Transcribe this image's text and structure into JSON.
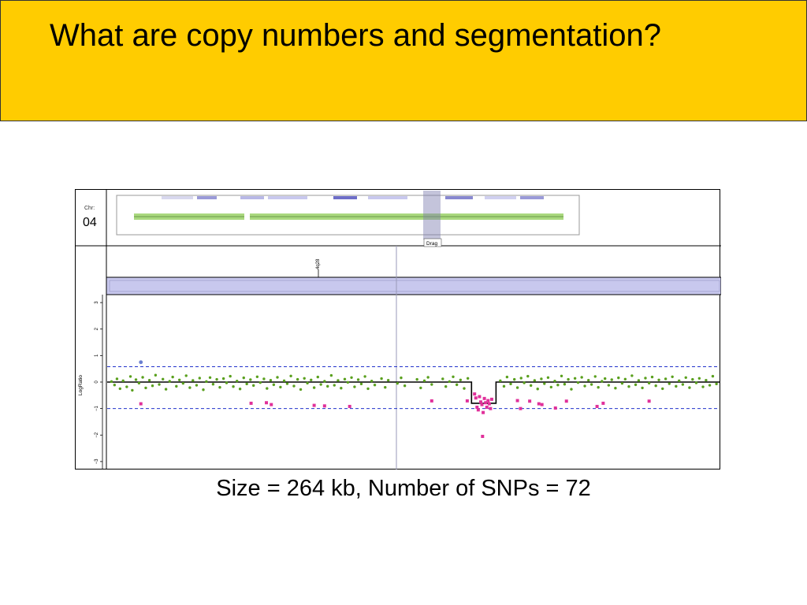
{
  "slide": {
    "title": "What are copy numbers and segmentation?",
    "caption": "Size = 264 kb, Number of SNPs = 72"
  },
  "colors": {
    "header_bg": "#ffcc00",
    "normal_points": "#5aa01e",
    "loss_points": "#e0309a",
    "outlier_point": "#6a7fd0",
    "threshold_lines": "#2233cc",
    "segment_line": "#000000",
    "track_fill": "#c8c8ee"
  },
  "chromosome_panel": {
    "chr_label": "Chr:",
    "chr_value": "04",
    "drag_label": "Drag"
  },
  "band_label": "4q28",
  "chart_data": {
    "type": "scatter",
    "title": "",
    "xlabel": "",
    "ylabel": "LogRatio",
    "ylim": [
      -3.3,
      3.3
    ],
    "yticks": [
      3,
      2,
      1,
      0,
      -1,
      -2,
      -3
    ],
    "ytick_labels": [
      "3",
      "2",
      "1",
      "0",
      "−1",
      "−2",
      "−3"
    ],
    "xlim": [
      0,
      1
    ],
    "thresholds": [
      0.58,
      -1.0
    ],
    "segments": [
      {
        "x": [
          0.0,
          0.595
        ],
        "y": 0.0
      },
      {
        "x": [
          0.595,
          0.635
        ],
        "y": -0.8
      },
      {
        "x": [
          0.635,
          1.0
        ],
        "y": 0.0
      }
    ],
    "series": [
      {
        "name": "",
        "role": "normal",
        "points": [
          [
            0.007,
            0.02
          ],
          [
            0.012,
            -0.11
          ],
          [
            0.016,
            0.12
          ],
          [
            0.021,
            -0.25
          ],
          [
            0.026,
            0.05
          ],
          [
            0.032,
            -0.18
          ],
          [
            0.038,
            0.21
          ],
          [
            0.041,
            -0.31
          ],
          [
            0.047,
            0.09
          ],
          [
            0.052,
            -0.04
          ],
          [
            0.058,
            0.18
          ],
          [
            0.063,
            -0.22
          ],
          [
            0.069,
            0.07
          ],
          [
            0.074,
            -0.14
          ],
          [
            0.079,
            0.26
          ],
          [
            0.085,
            -0.09
          ],
          [
            0.091,
            0.11
          ],
          [
            0.096,
            -0.27
          ],
          [
            0.102,
            0.03
          ],
          [
            0.107,
            0.19
          ],
          [
            0.113,
            -0.16
          ],
          [
            0.118,
            0.08
          ],
          [
            0.124,
            -0.05
          ],
          [
            0.129,
            0.24
          ],
          [
            0.135,
            -0.21
          ],
          [
            0.14,
            0.06
          ],
          [
            0.146,
            -0.12
          ],
          [
            0.151,
            0.15
          ],
          [
            0.157,
            -0.29
          ],
          [
            0.162,
            0.02
          ],
          [
            0.168,
            0.17
          ],
          [
            0.173,
            -0.08
          ],
          [
            0.179,
            0.1
          ],
          [
            0.184,
            -0.2
          ],
          [
            0.19,
            0.13
          ],
          [
            0.195,
            -0.03
          ],
          [
            0.201,
            0.22
          ],
          [
            0.206,
            -0.17
          ],
          [
            0.212,
            0.04
          ],
          [
            0.217,
            -0.26
          ],
          [
            0.223,
            0.16
          ],
          [
            0.228,
            -0.07
          ],
          [
            0.234,
            0.09
          ],
          [
            0.239,
            -0.13
          ],
          [
            0.245,
            0.2
          ],
          [
            0.25,
            -0.02
          ],
          [
            0.256,
            0.12
          ],
          [
            0.261,
            -0.24
          ],
          [
            0.267,
            0.07
          ],
          [
            0.272,
            -0.1
          ],
          [
            0.278,
            0.18
          ],
          [
            0.283,
            -0.19
          ],
          [
            0.289,
            0.05
          ],
          [
            0.294,
            -0.06
          ],
          [
            0.3,
            0.23
          ],
          [
            0.305,
            -0.15
          ],
          [
            0.311,
            0.1
          ],
          [
            0.316,
            -0.28
          ],
          [
            0.322,
            0.14
          ],
          [
            0.327,
            -0.04
          ],
          [
            0.333,
            0.08
          ],
          [
            0.338,
            -0.21
          ],
          [
            0.344,
            0.19
          ],
          [
            0.349,
            -0.09
          ],
          [
            0.355,
            0.03
          ],
          [
            0.36,
            -0.16
          ],
          [
            0.366,
            0.25
          ],
          [
            0.371,
            -0.12
          ],
          [
            0.377,
            0.06
          ],
          [
            0.382,
            -0.23
          ],
          [
            0.388,
            0.11
          ],
          [
            0.393,
            -0.01
          ],
          [
            0.399,
            0.17
          ],
          [
            0.404,
            -0.18
          ],
          [
            0.41,
            0.09
          ],
          [
            0.415,
            -0.07
          ],
          [
            0.421,
            0.21
          ],
          [
            0.426,
            -0.25
          ],
          [
            0.432,
            0.04
          ],
          [
            0.437,
            -0.11
          ],
          [
            0.448,
            0.13
          ],
          [
            0.454,
            -0.2
          ],
          [
            0.459,
            0.07
          ],
          [
            0.474,
            -0.05
          ],
          [
            0.48,
            0.16
          ],
          [
            0.486,
            -0.14
          ],
          [
            0.506,
            0.1
          ],
          [
            0.512,
            -0.22
          ],
          [
            0.518,
            0.05
          ],
          [
            0.524,
            0.18
          ],
          [
            0.53,
            -0.09
          ],
          [
            0.548,
            0.12
          ],
          [
            0.553,
            -0.17
          ],
          [
            0.559,
            0.02
          ],
          [
            0.565,
            0.2
          ],
          [
            0.571,
            -0.1
          ],
          [
            0.577,
            0.08
          ],
          [
            0.583,
            -0.24
          ],
          [
            0.589,
            0.14
          ],
          [
            0.642,
            0.05
          ],
          [
            0.648,
            -0.16
          ],
          [
            0.653,
            0.19
          ],
          [
            0.659,
            -0.07
          ],
          [
            0.665,
            0.1
          ],
          [
            0.67,
            -0.21
          ],
          [
            0.676,
            0.15
          ],
          [
            0.681,
            -0.03
          ],
          [
            0.687,
            0.22
          ],
          [
            0.692,
            -0.13
          ],
          [
            0.698,
            0.06
          ],
          [
            0.703,
            -0.26
          ],
          [
            0.709,
            0.12
          ],
          [
            0.714,
            -0.06
          ],
          [
            0.72,
            0.17
          ],
          [
            0.725,
            -0.19
          ],
          [
            0.731,
            0.04
          ],
          [
            0.736,
            -0.11
          ],
          [
            0.742,
            0.23
          ],
          [
            0.747,
            -0.08
          ],
          [
            0.753,
            0.1
          ],
          [
            0.758,
            -0.27
          ],
          [
            0.764,
            0.14
          ],
          [
            0.769,
            -0.02
          ],
          [
            0.775,
            0.18
          ],
          [
            0.78,
            -0.15
          ],
          [
            0.786,
            0.07
          ],
          [
            0.791,
            -0.09
          ],
          [
            0.797,
            0.21
          ],
          [
            0.802,
            -0.2
          ],
          [
            0.808,
            0.03
          ],
          [
            0.813,
            0.13
          ],
          [
            0.819,
            -0.12
          ],
          [
            0.824,
            0.09
          ],
          [
            0.83,
            -0.23
          ],
          [
            0.835,
            0.16
          ],
          [
            0.841,
            -0.05
          ],
          [
            0.846,
            0.11
          ],
          [
            0.852,
            -0.17
          ],
          [
            0.857,
            0.24
          ],
          [
            0.863,
            -0.1
          ],
          [
            0.868,
            0.06
          ],
          [
            0.874,
            -0.22
          ],
          [
            0.879,
            0.15
          ],
          [
            0.885,
            -0.04
          ],
          [
            0.89,
            0.19
          ],
          [
            0.896,
            -0.14
          ],
          [
            0.901,
            0.08
          ],
          [
            0.907,
            -0.25
          ],
          [
            0.912,
            0.12
          ],
          [
            0.918,
            -0.06
          ],
          [
            0.923,
            0.2
          ],
          [
            0.929,
            -0.16
          ],
          [
            0.934,
            0.05
          ],
          [
            0.94,
            -0.09
          ],
          [
            0.945,
            0.17
          ],
          [
            0.951,
            -0.21
          ],
          [
            0.956,
            0.1
          ],
          [
            0.962,
            -0.03
          ],
          [
            0.967,
            0.14
          ],
          [
            0.973,
            -0.18
          ],
          [
            0.978,
            0.07
          ],
          [
            0.984,
            -0.12
          ],
          [
            0.989,
            0.22
          ],
          [
            0.995,
            -0.07
          ]
        ]
      },
      {
        "name": "",
        "role": "loss",
        "points": [
          [
            0.055,
            -0.82
          ],
          [
            0.235,
            -0.8
          ],
          [
            0.26,
            -0.78
          ],
          [
            0.268,
            -0.85
          ],
          [
            0.338,
            -0.88
          ],
          [
            0.355,
            -0.9
          ],
          [
            0.396,
            -0.92
          ],
          [
            0.53,
            -0.71
          ],
          [
            0.588,
            -0.71
          ],
          [
            0.6,
            -0.45
          ],
          [
            0.602,
            -0.6
          ],
          [
            0.604,
            -0.95
          ],
          [
            0.606,
            -1.05
          ],
          [
            0.608,
            -0.55
          ],
          [
            0.61,
            -0.75
          ],
          [
            0.612,
            -0.85
          ],
          [
            0.614,
            -1.15
          ],
          [
            0.616,
            -0.62
          ],
          [
            0.618,
            -0.78
          ],
          [
            0.62,
            -0.95
          ],
          [
            0.622,
            -0.7
          ],
          [
            0.624,
            -0.82
          ],
          [
            0.626,
            -1.0
          ],
          [
            0.628,
            -0.65
          ],
          [
            0.613,
            -2.05
          ],
          [
            0.67,
            -0.7
          ],
          [
            0.675,
            -1.0
          ],
          [
            0.69,
            -0.72
          ],
          [
            0.705,
            -0.82
          ],
          [
            0.71,
            -0.85
          ],
          [
            0.732,
            -0.98
          ],
          [
            0.75,
            -0.72
          ],
          [
            0.8,
            -0.92
          ],
          [
            0.81,
            -0.8
          ],
          [
            0.885,
            -0.72
          ]
        ]
      },
      {
        "name": "",
        "role": "outlier",
        "points": [
          [
            0.055,
            0.75
          ]
        ]
      }
    ]
  }
}
